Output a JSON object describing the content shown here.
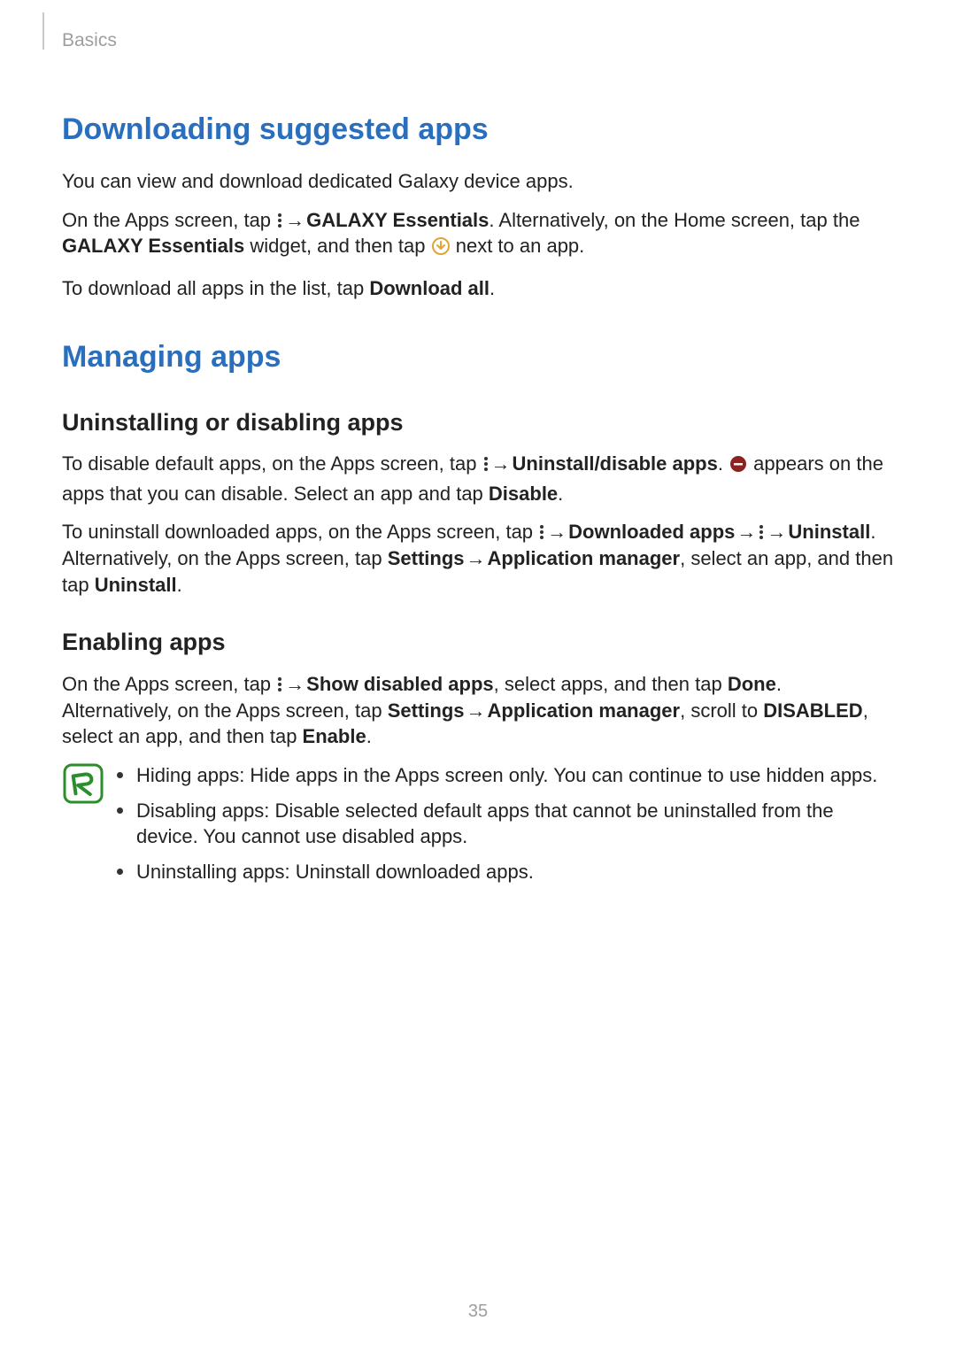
{
  "header": {
    "section": "Basics"
  },
  "h1": "Downloading suggested apps",
  "p1_a": "You can view and download dedicated Galaxy device apps.",
  "p2_a": "On the Apps screen, tap ",
  "p2_b": " → ",
  "p2_c": "GALAXY Essentials",
  "p2_d": ". Alternatively, on the Home screen, tap the ",
  "p2_e": "GALAXY Essentials",
  "p2_f": " widget, and then tap ",
  "p2_g": " next to an app.",
  "p3_a": "To download all apps in the list, tap ",
  "p3_b": "Download all",
  "p3_c": ".",
  "h2": "Managing apps",
  "h3a": "Uninstalling or disabling apps",
  "p4_a": "To disable default apps, on the Apps screen, tap ",
  "p4_b": " → ",
  "p4_c": "Uninstall/disable apps",
  "p4_d": ". ",
  "p4_e": " appears on the apps that you can disable. Select an app and tap ",
  "p4_f": "Disable",
  "p4_g": ".",
  "p5_a": "To uninstall downloaded apps, on the Apps screen, tap ",
  "p5_b": " → ",
  "p5_c": "Downloaded apps",
  "p5_d": " → ",
  "p5_e": " → ",
  "p5_f": "Uninstall",
  "p5_g": ". Alternatively, on the Apps screen, tap ",
  "p5_h": "Settings",
  "p5_i": " → ",
  "p5_j": "Application manager",
  "p5_k": ", select an app, and then tap ",
  "p5_l": "Uninstall",
  "p5_m": ".",
  "h3b": "Enabling apps",
  "p6_a": "On the Apps screen, tap ",
  "p6_b": " → ",
  "p6_c": "Show disabled apps",
  "p6_d": ", select apps, and then tap ",
  "p6_e": "Done",
  "p6_f": ". Alternatively, on the Apps screen, tap ",
  "p6_g": "Settings",
  "p6_h": " → ",
  "p6_i": "Application manager",
  "p6_j": ", scroll to ",
  "p6_k": "DISABLED",
  "p6_l": ", select an app, and then tap ",
  "p6_m": "Enable",
  "p6_n": ".",
  "li1": "Hiding apps: Hide apps in the Apps screen only. You can continue to use hidden apps.",
  "li2": "Disabling apps: Disable selected default apps that cannot be uninstalled from the device. You cannot use disabled apps.",
  "li3": "Uninstalling apps: Uninstall downloaded apps.",
  "page": "35"
}
